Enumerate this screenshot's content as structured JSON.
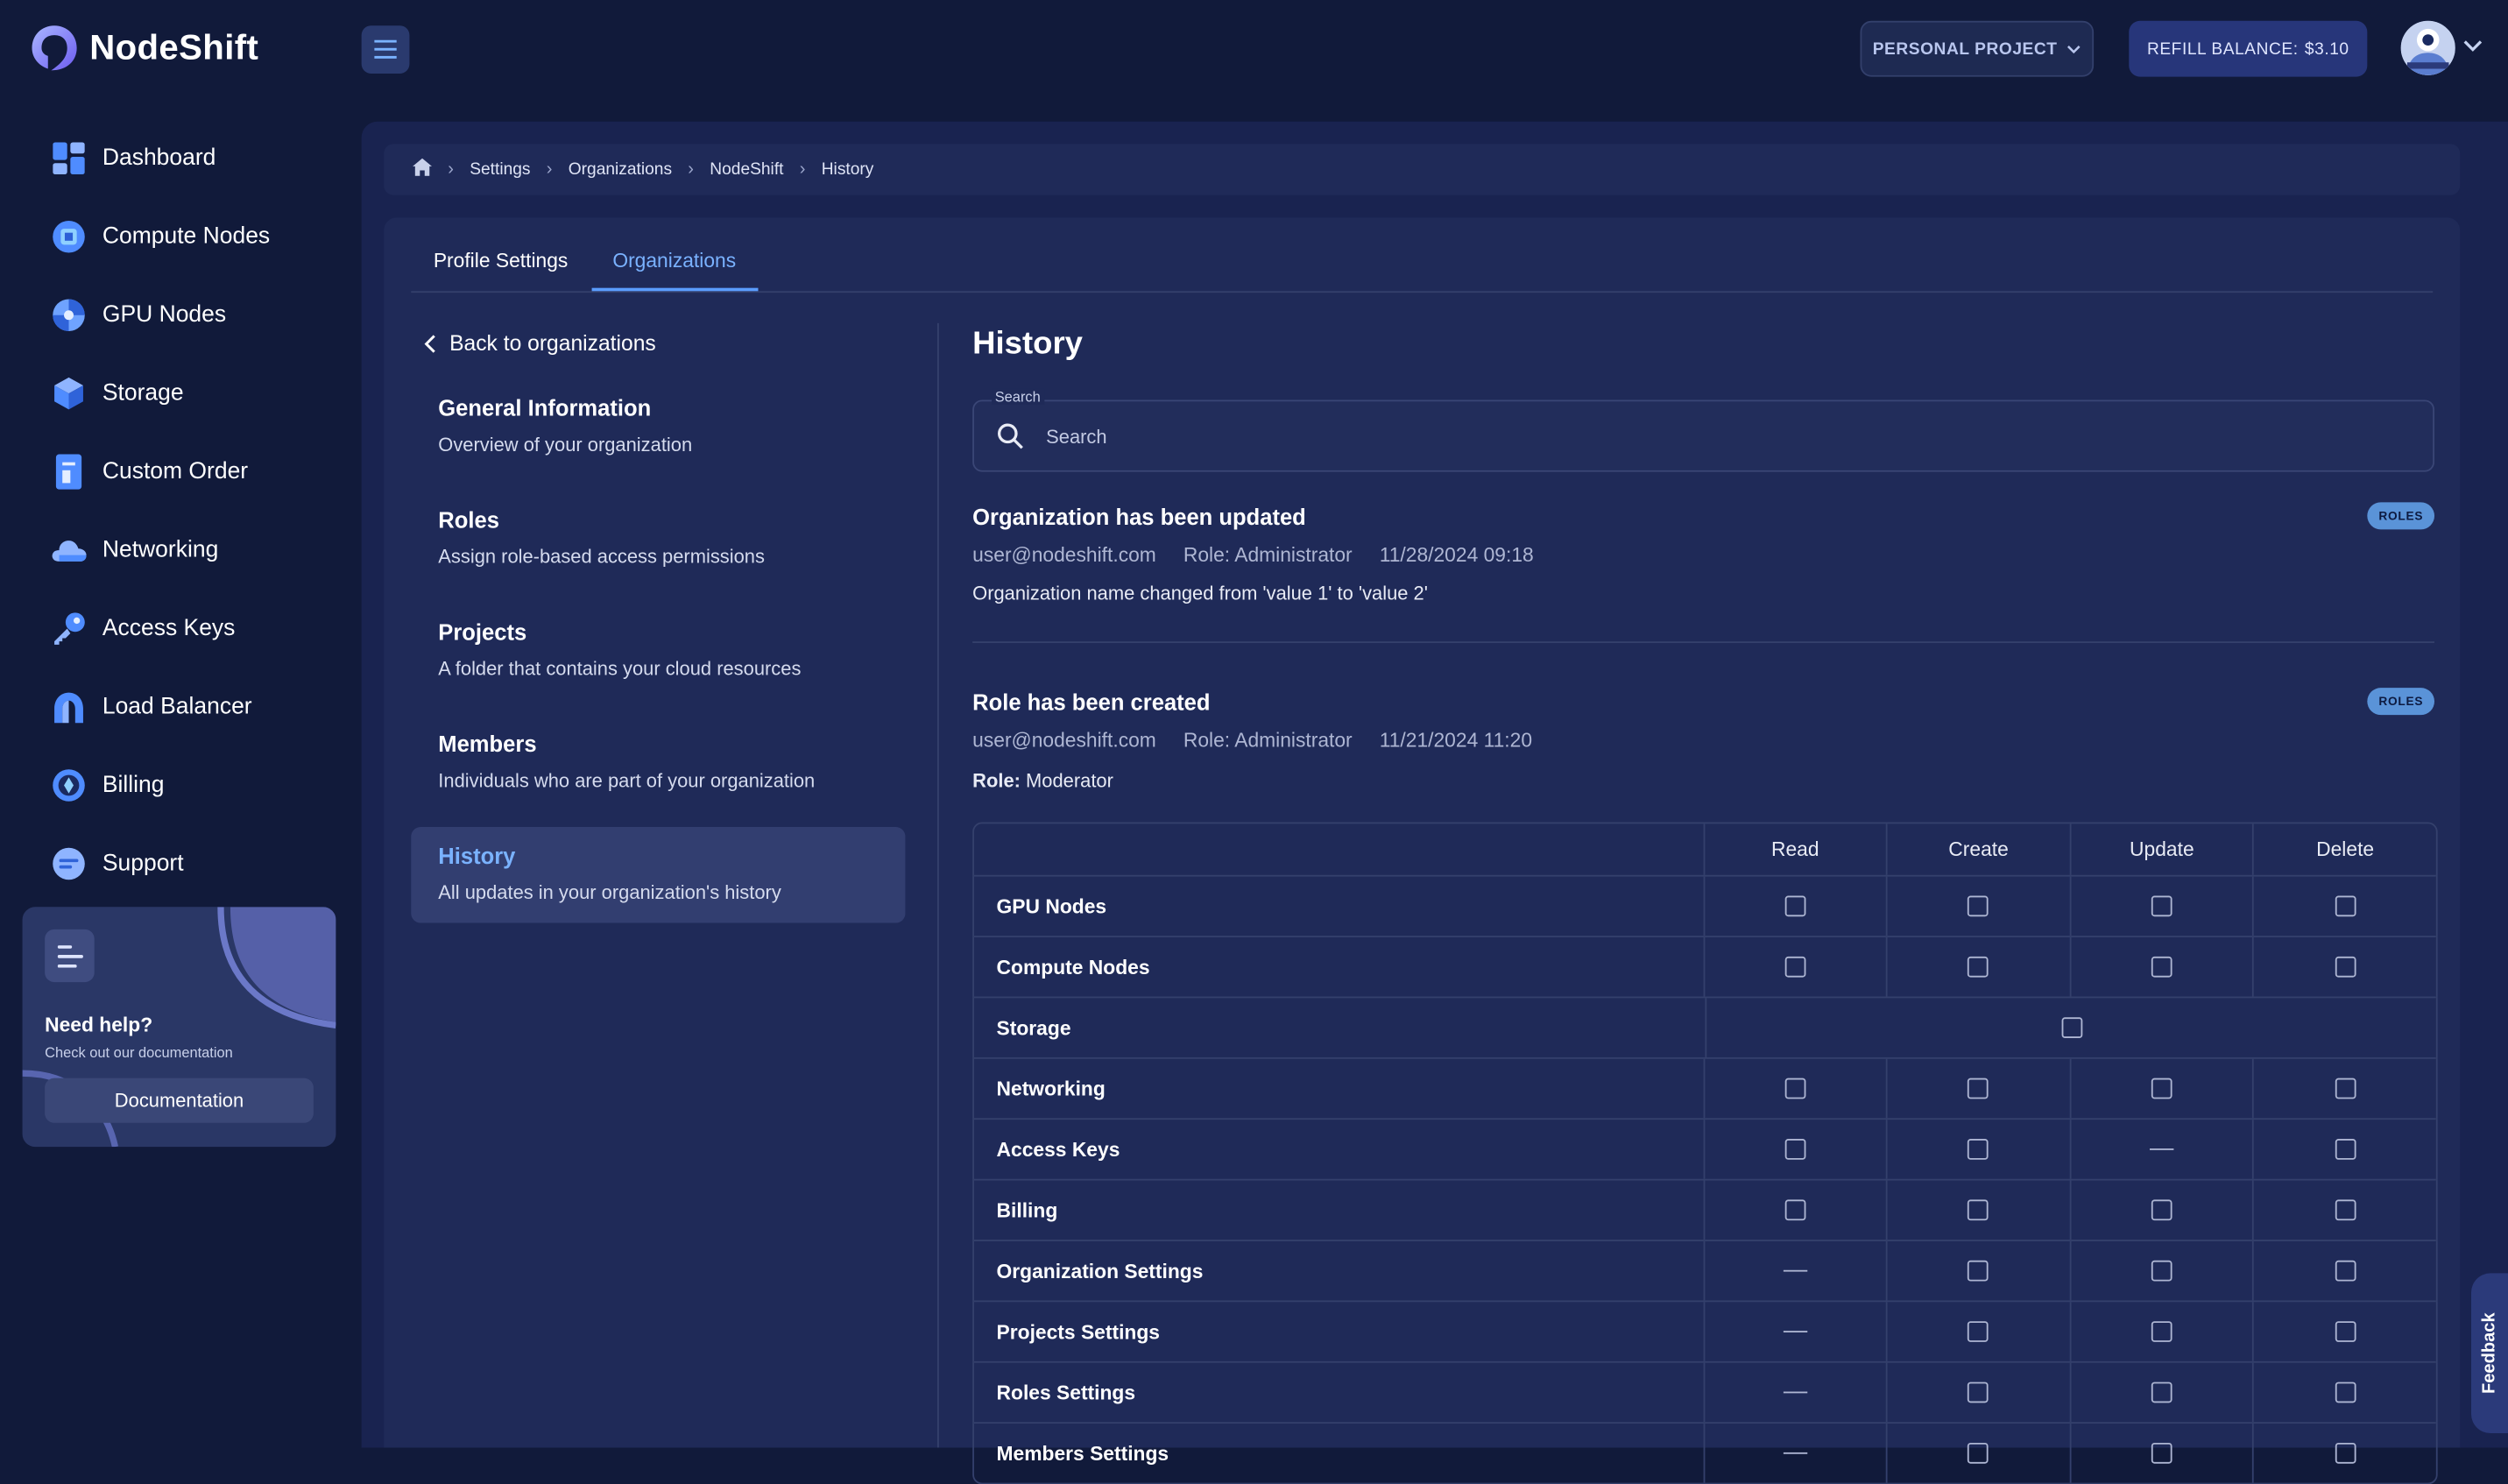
{
  "brand": {
    "name": "NodeShift"
  },
  "header": {
    "project_label": "PERSONAL PROJECT",
    "refill_label": "REFILL BALANCE:",
    "refill_amount": "$3.10"
  },
  "sidebar": {
    "items": [
      {
        "label": "Dashboard",
        "icon": "dashboard-icon"
      },
      {
        "label": "Compute Nodes",
        "icon": "cpu-icon"
      },
      {
        "label": "GPU Nodes",
        "icon": "gpu-icon"
      },
      {
        "label": "Storage",
        "icon": "cube-icon"
      },
      {
        "label": "Custom Order",
        "icon": "order-icon"
      },
      {
        "label": "Networking",
        "icon": "cloud-icon"
      },
      {
        "label": "Access Keys",
        "icon": "key-icon"
      },
      {
        "label": "Load Balancer",
        "icon": "balancer-icon"
      },
      {
        "label": "Billing",
        "icon": "billing-icon"
      },
      {
        "label": "Support",
        "icon": "support-icon"
      }
    ],
    "help": {
      "title": "Need help?",
      "subtitle": "Check out our documentation",
      "button": "Documentation"
    }
  },
  "breadcrumb": [
    "Settings",
    "Organizations",
    "NodeShift",
    "History"
  ],
  "tabs": [
    {
      "label": "Profile Settings"
    },
    {
      "label": "Organizations"
    }
  ],
  "org_nav": {
    "back_label": "Back to organizations",
    "sections": [
      {
        "title": "General Information",
        "desc": "Overview of your organization"
      },
      {
        "title": "Roles",
        "desc": "Assign role-based access permissions"
      },
      {
        "title": "Projects",
        "desc": "A folder that contains your cloud resources"
      },
      {
        "title": "Members",
        "desc": "Individuals who are part of your organization"
      },
      {
        "title": "History",
        "desc": "All updates in your organization's history"
      }
    ]
  },
  "history": {
    "title": "History",
    "search_label": "Search",
    "search_placeholder": "Search",
    "entries": [
      {
        "title": "Organization has been updated",
        "badge": "ROLES",
        "user": "user@nodeshift.com",
        "role": "Role: Administrator",
        "timestamp": "11/28/2024 09:18",
        "detail": "Organization name changed from 'value 1' to 'value 2'"
      },
      {
        "title": "Role has been created",
        "badge": "ROLES",
        "user": "user@nodeshift.com",
        "role": "Role: Administrator",
        "timestamp": "11/21/2024 11:20",
        "role_label": "Role:",
        "role_value": "Moderator"
      }
    ]
  },
  "permissions": {
    "columns": [
      "Read",
      "Create",
      "Update",
      "Delete"
    ],
    "rows": [
      {
        "name": "GPU Nodes",
        "cells": [
          "box",
          "box",
          "box",
          "box"
        ]
      },
      {
        "name": "Compute Nodes",
        "cells": [
          "box",
          "box",
          "box",
          "box"
        ]
      },
      {
        "name": "Storage",
        "cells": [
          "single"
        ]
      },
      {
        "name": "Networking",
        "cells": [
          "box",
          "box",
          "box",
          "box"
        ]
      },
      {
        "name": "Access Keys",
        "cells": [
          "box",
          "box",
          "dash",
          "box"
        ]
      },
      {
        "name": "Billing",
        "cells": [
          "box",
          "box",
          "box",
          "box"
        ]
      },
      {
        "name": "Organization Settings",
        "cells": [
          "dash",
          "box",
          "box",
          "box"
        ]
      },
      {
        "name": "Projects Settings",
        "cells": [
          "dash",
          "box",
          "box",
          "box"
        ]
      },
      {
        "name": "Roles Settings",
        "cells": [
          "dash",
          "box",
          "box",
          "box"
        ]
      },
      {
        "name": "Members Settings",
        "cells": [
          "dash",
          "box",
          "box",
          "box"
        ]
      }
    ]
  },
  "feedback_label": "Feedback",
  "colors": {
    "accent": "#7ab2ff",
    "background": "#111a3a",
    "panel": "#1f2a58"
  }
}
